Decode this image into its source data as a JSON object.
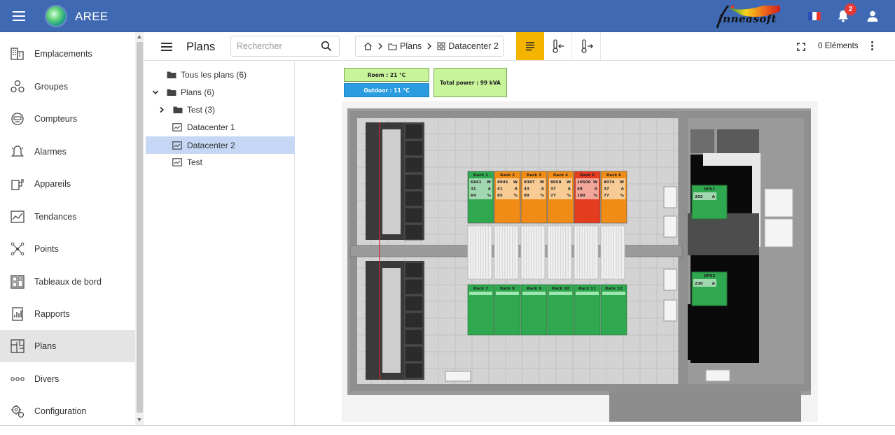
{
  "app": {
    "title": "AREE",
    "brand": "inneasoft",
    "notifications": "2"
  },
  "sidebar": {
    "items": [
      {
        "label": "Emplacements",
        "icon": "building-icon"
      },
      {
        "label": "Groupes",
        "icon": "groups-icon"
      },
      {
        "label": "Compteurs",
        "icon": "meter-icon"
      },
      {
        "label": "Alarmes",
        "icon": "alarm-icon"
      },
      {
        "label": "Appareils",
        "icon": "devices-icon"
      },
      {
        "label": "Tendances",
        "icon": "trend-icon"
      },
      {
        "label": "Points",
        "icon": "points-icon"
      },
      {
        "label": "Tableaux de bord",
        "icon": "dashboard-icon"
      },
      {
        "label": "Rapports",
        "icon": "report-icon"
      },
      {
        "label": "Plans",
        "icon": "plans-icon",
        "active": true
      },
      {
        "label": "Divers",
        "icon": "more-icon"
      },
      {
        "label": "Configuration",
        "icon": "config-icon"
      }
    ]
  },
  "toolbar": {
    "title": "Plans",
    "search_placeholder": "Rechercher",
    "breadcrumb": [
      "Plans",
      "Datacenter 2"
    ],
    "count": "0 Eléments"
  },
  "tree": {
    "items": [
      {
        "label": "Tous les plans (6)",
        "type": "folder"
      },
      {
        "label": "Plans (6)",
        "type": "folder",
        "expanded": true
      },
      {
        "label": "Test (3)",
        "type": "folder",
        "collapsed": true
      },
      {
        "label": "Datacenter 1",
        "type": "plan"
      },
      {
        "label": "Datacenter 2",
        "type": "plan",
        "selected": true
      },
      {
        "label": "Test",
        "type": "plan"
      }
    ]
  },
  "plan": {
    "room": "Room : 21 °C",
    "outdoor": "Outdoor : 11 °C",
    "total_power": "Total power : 99 kVA",
    "racks_top": [
      {
        "name": "Rack 1",
        "w": "6841",
        "a": "31",
        "p": "64",
        "color": "#2fa84f"
      },
      {
        "name": "Rack 2",
        "w": "8945",
        "a": "41",
        "p": "85",
        "color": "#f08c16"
      },
      {
        "name": "Rack 3",
        "w": "9387",
        "a": "43",
        "p": "89",
        "color": "#f08c16"
      },
      {
        "name": "Rack 4",
        "w": "8058",
        "a": "37",
        "p": "77",
        "color": "#f08c16"
      },
      {
        "name": "Rack 5",
        "w": "10500",
        "a": "48",
        "p": "100",
        "color": "#e53b1f"
      },
      {
        "name": "Rack 6",
        "w": "8074",
        "a": "37",
        "p": "77",
        "color": "#f08c16"
      }
    ],
    "racks_bottom": [
      {
        "name": "Rack 7"
      },
      {
        "name": "Rack 8"
      },
      {
        "name": "Rack 9"
      },
      {
        "name": "Rack 10"
      },
      {
        "name": "Rack 11"
      },
      {
        "name": "Rack 12"
      }
    ],
    "units": {
      "w": "W",
      "a": "A",
      "p": "%"
    },
    "ups": [
      {
        "name": "UPS1",
        "value": "202",
        "unit": "A"
      },
      {
        "name": "UPS2",
        "value": "230",
        "unit": "A"
      }
    ],
    "colors": {
      "green": "#2fa84f",
      "orange": "#f08c16",
      "red": "#e53b1f",
      "room_bg": "#c8f59a",
      "outdoor_bg": "#2b9ce0"
    }
  }
}
